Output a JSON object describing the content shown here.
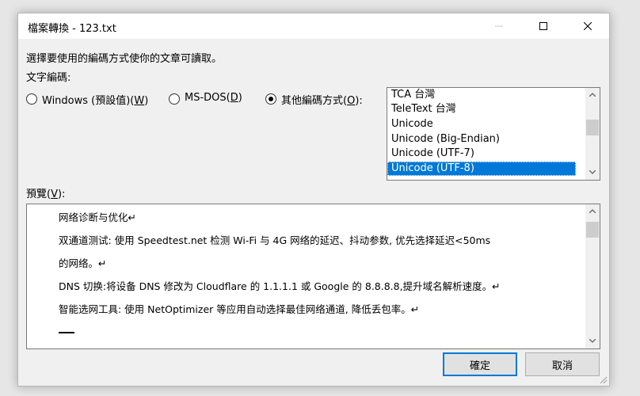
{
  "window": {
    "title": "檔案轉換 - 123.txt"
  },
  "instructions": "選擇要使用的編碼方式使你的文章可讀取。",
  "encoding_label": "文字編碼:",
  "options": [
    {
      "label_pre": "Windows (預設值)(",
      "accel": "W",
      "label_post": ")",
      "selected": false
    },
    {
      "label_pre": "MS-DOS(",
      "accel": "D",
      "label_post": ")",
      "selected": false
    },
    {
      "label_pre": "其他編碼方式(",
      "accel": "O",
      "label_post": "):",
      "selected": true
    }
  ],
  "encoding_list": {
    "items": [
      "TCA 台灣",
      "TeleText 台灣",
      "Unicode",
      "Unicode (Big-Endian)",
      "Unicode (UTF-7)",
      "Unicode (UTF-8)"
    ],
    "selected": "Unicode (UTF-8)"
  },
  "preview": {
    "label_pre": "預覽(",
    "accel": "V",
    "label_post": "):",
    "lines": [
      "网络诊断与优化↵",
      "双通道测试: 使用 Speedtest.net 检测 Wi-Fi 与 4G 网络的延迟、抖动参数, 优先选择延迟<50ms",
      "的网络。↵",
      "DNS 切换:将设备 DNS 修改为 Cloudflare 的 1.1.1.1 或 Google 的 8.8.8.8,提升域名解析速度。↵",
      "智能选网工具: 使用 NetOptimizer 等应用自动选择最佳网络通道, 降低丢包率。↵"
    ]
  },
  "buttons": {
    "ok": "確定",
    "cancel": "取消"
  }
}
